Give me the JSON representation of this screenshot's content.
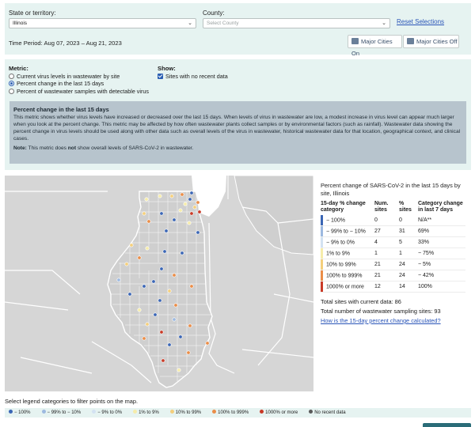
{
  "filters": {
    "state_label": "State or territory:",
    "state_value": "Illinois",
    "county_label": "County:",
    "county_placeholder": "Select County",
    "reset_label": "Reset Selections",
    "time_period": "Time Period: Aug 07, 2023 – Aug 21, 2023",
    "major_on": "Major Cities On",
    "major_off": "Major Cities Off"
  },
  "metric": {
    "label": "Metric:",
    "options": [
      "Current virus levels in wastewater by site",
      "Percent change in the last 15 days",
      "Percent of wastewater samples with detectable virus"
    ],
    "selected_index": 1,
    "show_label": "Show:",
    "show_option": "Sites with no recent data"
  },
  "info": {
    "title": "Percent change in the last 15 days",
    "body": "This metric shows whether virus levels have increased or decreased over the last 15 days. When levels of virus in wastewater are low, a modest increase in virus level can appear much larger when you look at the percent change. This metric may be affected by how often wastewater plants collect samples or by environmental factors (such as rainfall). Wastewater data showing the percent change in virus levels should be used along with other data such as overall levels of the virus in wastewater, historical wastewater data for that location, geographical context, and clinical cases.",
    "note_label": "Note:",
    "note_pre": " This metric does ",
    "note_bold": "not",
    "note_post": " show overall levels of SARS-CoV-2 in wastewater."
  },
  "legend_panel": {
    "header": "Percent change of SARS-CoV-2 in the last 15 days by site, Illinois",
    "col_category": "15-day % change category",
    "col_num": "Num. sites",
    "col_pct": "% sites",
    "col_change": "Category change in last 7 days",
    "rows": [
      {
        "category": "− 100%",
        "num": "0",
        "pct": "0",
        "change": "N/A**",
        "color": "#3b66b5"
      },
      {
        "category": "− 99% to − 10%",
        "num": "27",
        "pct": "31",
        "change": "69%",
        "color": "#9db9e0"
      },
      {
        "category": "− 9% to 0%",
        "num": "4",
        "pct": "5",
        "change": "33%",
        "color": "#d3e2f2"
      },
      {
        "category": "1% to 9%",
        "num": "1",
        "pct": "1",
        "change": "− 75%",
        "color": "#f6ecaa"
      },
      {
        "category": "10% to 99%",
        "num": "21",
        "pct": "24",
        "change": "− 5%",
        "color": "#f4cf7c"
      },
      {
        "category": "100% to 999%",
        "num": "21",
        "pct": "24",
        "change": "− 42%",
        "color": "#ea8d48"
      },
      {
        "category": "1000% or more",
        "num": "12",
        "pct": "14",
        "change": "100%",
        "color": "#c93a27"
      }
    ],
    "total_current": "Total sites with current data: 86",
    "total_sampling": "Total number of wastewater sampling sites: 93",
    "how_link": "How is the 15-day percent change calculated?"
  },
  "bottom": {
    "filter_label": "Select legend categories to filter points on the map.",
    "items": [
      {
        "label": "− 100%",
        "color": "#3b66b5"
      },
      {
        "label": "− 99% to − 10%",
        "color": "#9db9e0"
      },
      {
        "label": "− 9% to 0%",
        "color": "#d3e2f2"
      },
      {
        "label": "1% to 9%",
        "color": "#f6ecaa"
      },
      {
        "label": "10% to 99%",
        "color": "#f4cf7c"
      },
      {
        "label": "100% to 999%",
        "color": "#ea8d48"
      },
      {
        "label": "1000% or more",
        "color": "#c93a27"
      },
      {
        "label": "No recent data",
        "color": "#5a5a5a"
      }
    ]
  },
  "map": {
    "colors": {
      "lake": "#ffffff",
      "land": "#d6d6d6",
      "state": "#ffffff",
      "border": "#ffffff"
    },
    "sites": [
      {
        "c": 4
      },
      {
        "c": 4
      },
      {
        "c": 5
      },
      {
        "c": 6
      },
      {
        "c": 1
      },
      {
        "c": 1
      },
      {
        "c": 4
      },
      {
        "c": 5
      },
      {
        "c": 6
      },
      {
        "c": 7
      },
      {
        "c": 7
      },
      {
        "c": 4
      },
      {
        "c": 1
      },
      {
        "c": 5
      },
      {
        "c": 6
      },
      {
        "c": 1
      },
      {
        "c": 4
      },
      {
        "c": 1
      },
      {
        "c": 1
      },
      {
        "c": 5
      },
      {
        "c": 4
      },
      {
        "c": 1
      },
      {
        "c": 1
      },
      {
        "c": 6
      },
      {
        "c": 5
      },
      {
        "c": 1
      },
      {
        "c": 6
      },
      {
        "c": 1
      },
      {
        "c": 2
      },
      {
        "c": 1
      },
      {
        "c": 6
      },
      {
        "c": 5
      },
      {
        "c": 1
      },
      {
        "c": 1
      },
      {
        "c": 6
      },
      {
        "c": 4
      },
      {
        "c": 1
      },
      {
        "c": 2
      },
      {
        "c": 6
      },
      {
        "c": 5
      },
      {
        "c": 7
      },
      {
        "c": 1
      },
      {
        "c": 6
      },
      {
        "c": 1
      },
      {
        "c": 6
      },
      {
        "c": 6
      },
      {
        "c": 7
      },
      {
        "c": 4
      }
    ]
  }
}
